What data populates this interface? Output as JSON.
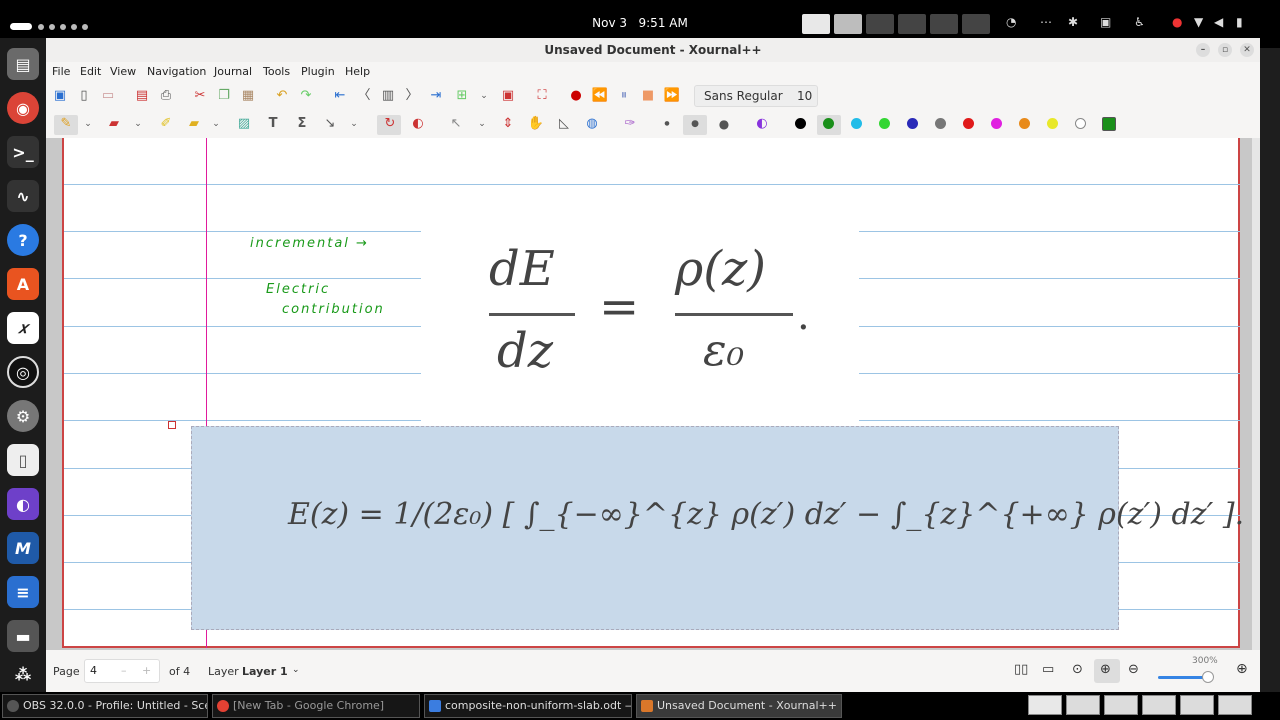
{
  "system": {
    "date": "Nov 3",
    "time": "9:51 AM"
  },
  "window": {
    "title": "Unsaved Document - Xournal++"
  },
  "menu": [
    "File",
    "Edit",
    "View",
    "Navigation",
    "Journal",
    "Tools",
    "Plugin",
    "Help"
  ],
  "toolbar": {
    "font_name": "Sans Regular",
    "font_size": "10"
  },
  "palette": [
    "#000000",
    "#1a8f1a",
    "#22bce8",
    "#33d633",
    "#2a2ab8",
    "#777777",
    "#e01a1a",
    "#e020e0",
    "#e88a1a",
    "#e8e82a",
    "#ffffff",
    "#1a8f1a"
  ],
  "document": {
    "annotation_line1": "incremental →",
    "annotation_line2": "Electric",
    "annotation_line3": "contribution",
    "equation1_lhs_num": "dE",
    "equation1_lhs_den": "dz",
    "equation1_rhs_num": "ρ(z)",
    "equation1_rhs_den": "ε₀",
    "equation2": "E(z) = 1/(2ε₀) [ ∫_{−∞}^{z} ρ(z′) dz′ − ∫_{z}^{+∞} ρ(z′) dz′ ]."
  },
  "statusbar": {
    "page_label": "Page",
    "page_value": "4",
    "page_total": "of 4",
    "layer_label": "Layer",
    "layer_value": "Layer 1",
    "zoom": "300%"
  },
  "taskbar": [
    {
      "label": "OBS 32.0.0 - Profile: Untitled - Scen...",
      "color": "#555"
    },
    {
      "label": "[New Tab - Google Chrome]",
      "color": "#e34133"
    },
    {
      "label": "composite-non-uniform-slab.odt — ...",
      "color": "#3b7de0"
    },
    {
      "label": "Unsaved Document - Xournal++",
      "color": "#d9772a"
    }
  ]
}
